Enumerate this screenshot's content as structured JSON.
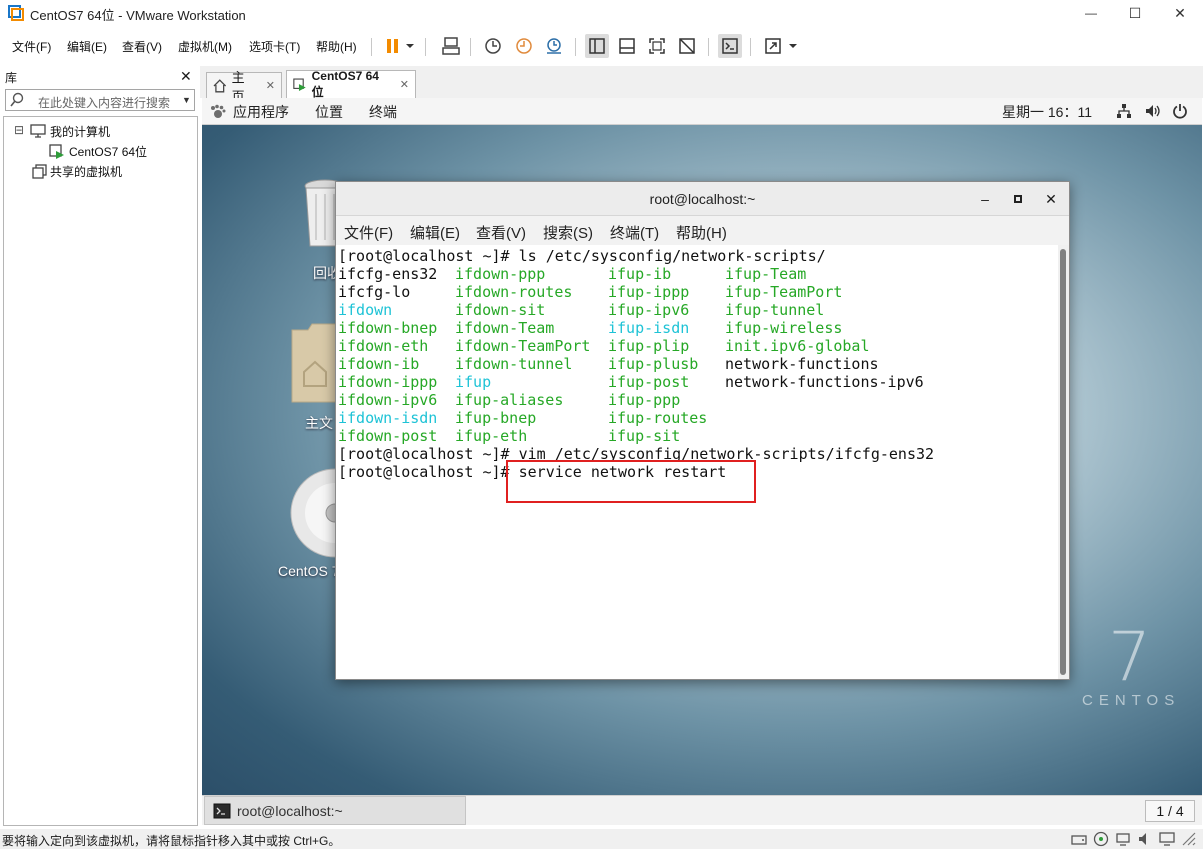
{
  "window": {
    "title": "CentOS7 64位 - VMware Workstation",
    "minimize_glyph": "—",
    "maximize_glyph": "☐",
    "close_glyph": "✕"
  },
  "menu": {
    "items": [
      "文件(F)",
      "编辑(E)",
      "查看(V)",
      "虚拟机(M)",
      "选项卡(T)",
      "帮助(H)"
    ]
  },
  "toolbar": {
    "icons": [
      "pause-icon",
      "send-keys-icon",
      "snapshot-icon",
      "revert-snapshot-icon",
      "snapshot-manager-icon",
      "sidebar-toggle-icon",
      "thumbnail-icon",
      "fullscreen-icon",
      "unity-icon",
      "console-icon",
      "stretch-icon"
    ]
  },
  "library": {
    "title": "库",
    "close_glyph": "✕",
    "search_placeholder": "在此处键入内容进行搜索",
    "tree": {
      "my_computer": "我的计算机",
      "vm_name": "CentOS7 64位",
      "shared_vms": "共享的虚拟机",
      "expander": "⊟"
    }
  },
  "tabs": [
    {
      "label": "主页",
      "close": "✕"
    },
    {
      "label": "CentOS7 64位",
      "close": "✕"
    }
  ],
  "gnome_bar": {
    "applications": "应用程序",
    "places": "位置",
    "terminal": "终端",
    "clock": "星期一 16：11"
  },
  "desktop": {
    "icons": [
      {
        "label": "回收",
        "icon": "trash-icon"
      },
      {
        "label": "主文",
        "icon": "home-folder-icon"
      },
      {
        "label": "CentOS 7",
        "icon": "cd-icon"
      }
    ],
    "watermark_number": "7",
    "watermark_text": "CENTOS"
  },
  "terminal": {
    "title": "root@localhost:~",
    "controls": [
      "–",
      "▫",
      "✕"
    ],
    "menus": [
      "文件(F)",
      "编辑(E)",
      "查看(V)",
      "搜索(S)",
      "终端(T)",
      "帮助(H)"
    ],
    "prompt": "[root@localhost ~]# ",
    "cmd1": "ls /etc/sysconfig/network-scripts/",
    "cmd2": "vim /etc/sysconfig/network-scripts/ifcfg-ens32",
    "cmd3": "service network restart",
    "listing": [
      [
        "ifcfg-ens32",
        "ifdown-ppp",
        "ifup-ib",
        "ifup-Team"
      ],
      [
        "ifcfg-lo",
        "ifdown-routes",
        "ifup-ippp",
        "ifup-TeamPort"
      ],
      [
        "ifdown",
        "ifdown-sit",
        "ifup-ipv6",
        "ifup-tunnel"
      ],
      [
        "ifdown-bnep",
        "ifdown-Team",
        "ifup-isdn",
        "ifup-wireless"
      ],
      [
        "ifdown-eth",
        "ifdown-TeamPort",
        "ifup-plip",
        "init.ipv6-global"
      ],
      [
        "ifdown-ib",
        "ifdown-tunnel",
        "ifup-plusb",
        "network-functions"
      ],
      [
        "ifdown-ippp",
        "ifup",
        "ifup-post",
        "network-functions-ipv6"
      ],
      [
        "ifdown-ipv6",
        "ifup-aliases",
        "ifup-ppp",
        ""
      ],
      [
        "ifdown-isdn",
        "ifup-bnep",
        "ifup-routes",
        ""
      ],
      [
        "ifdown-post",
        "ifup-eth",
        "ifup-sit",
        ""
      ]
    ],
    "listing_colors": [
      [
        "plain",
        "green",
        "green",
        "green"
      ],
      [
        "plain",
        "green",
        "green",
        "green"
      ],
      [
        "cyan",
        "green",
        "green",
        "green"
      ],
      [
        "green",
        "green",
        "cyan",
        "green"
      ],
      [
        "green",
        "green",
        "green",
        "green"
      ],
      [
        "green",
        "green",
        "green",
        "plain"
      ],
      [
        "green",
        "cyan",
        "green",
        "plain"
      ],
      [
        "green",
        "green",
        "green",
        "plain"
      ],
      [
        "cyan",
        "green",
        "green",
        "plain"
      ],
      [
        "green",
        "green",
        "green",
        "plain"
      ]
    ]
  },
  "guest_taskbar": {
    "item": "root@localhost:~",
    "page": "1 / 4"
  },
  "statusbar": {
    "text": "要将输入定向到该虚拟机，请将鼠标指针移入其中或按 Ctrl+G。"
  },
  "colors": {
    "green": "#26a826",
    "cyan": "#1ec3d6",
    "highlight": "#e02020",
    "vmware_orange": "#f38b00"
  }
}
